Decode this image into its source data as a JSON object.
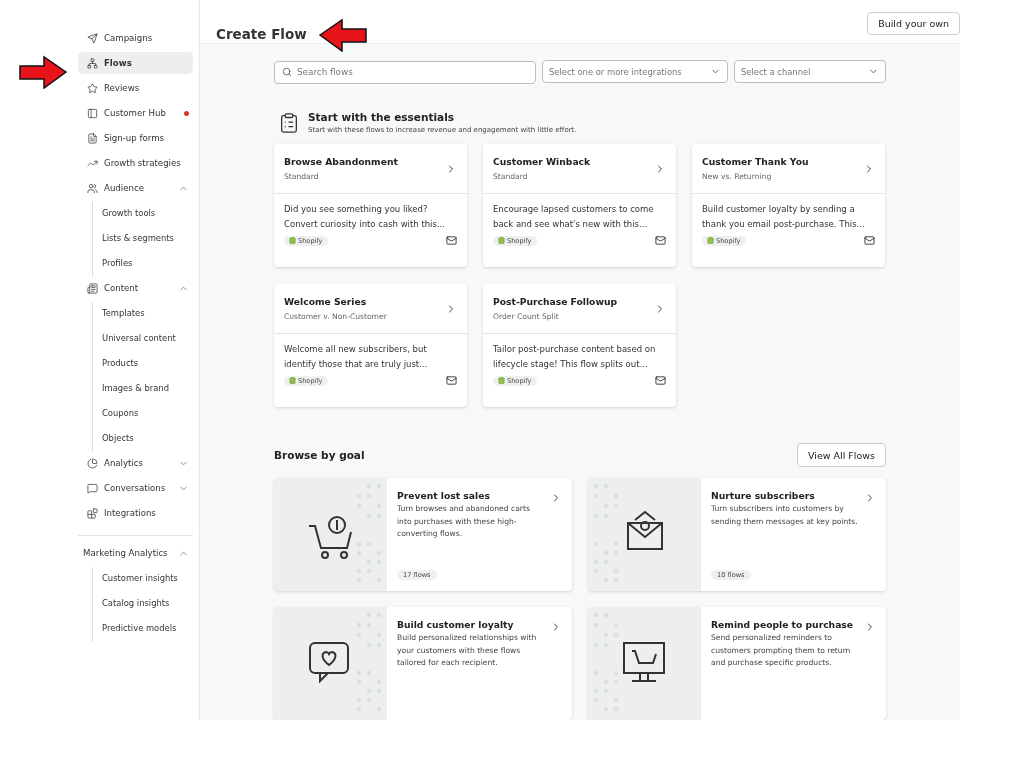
{
  "sidebar": {
    "items": [
      {
        "label": "Campaigns",
        "selected": false,
        "notification": false
      },
      {
        "label": "Flows",
        "selected": true,
        "notification": false
      },
      {
        "label": "Reviews",
        "selected": false,
        "notification": false
      },
      {
        "label": "Customer Hub",
        "selected": false,
        "notification": true
      },
      {
        "label": "Sign-up forms",
        "selected": false,
        "notification": false
      },
      {
        "label": "Growth strategies",
        "selected": false,
        "notification": false
      },
      {
        "label": "Audience",
        "selected": false,
        "notification": false,
        "expanded": true,
        "children": [
          {
            "label": "Growth tools",
            "selected": false
          },
          {
            "label": "Lists & segments",
            "selected": false
          },
          {
            "label": "Profiles",
            "selected": false
          }
        ]
      },
      {
        "label": "Content",
        "selected": false,
        "notification": false,
        "expanded": true,
        "children": [
          {
            "label": "Templates",
            "selected": false
          },
          {
            "label": "Universal content",
            "selected": false
          },
          {
            "label": "Products",
            "selected": false
          },
          {
            "label": "Images & brand",
            "selected": false
          },
          {
            "label": "Coupons",
            "selected": false
          },
          {
            "label": "Objects",
            "selected": false
          }
        ]
      },
      {
        "label": "Analytics",
        "selected": false,
        "notification": false,
        "expanded": false
      },
      {
        "label": "Conversations",
        "selected": false,
        "notification": false,
        "expanded": false
      },
      {
        "label": "Integrations",
        "selected": false,
        "notification": false
      }
    ],
    "section": {
      "label": "Marketing Analytics",
      "expanded": true,
      "children": [
        {
          "label": "Customer insights",
          "selected": false
        },
        {
          "label": "Catalog insights",
          "selected": false
        },
        {
          "label": "Predictive models",
          "selected": false
        }
      ]
    }
  },
  "header": {
    "title": "Create Flow",
    "button": "Build your own"
  },
  "filters": {
    "search": {
      "placeholder": "Search flows"
    },
    "integrations": {
      "placeholder": "Select one or more integrations"
    },
    "channel": {
      "placeholder": "Select a channel"
    }
  },
  "essentials": {
    "title": "Start with the essentials",
    "subtitle": "Start with these flows to increase revenue and engagement with little effort.",
    "cards": [
      {
        "title": "Browse Abandonment",
        "subtitle": "Standard",
        "description": "Did you see something you liked? Convert curiosity into cash with this...",
        "tag": "Shopify"
      },
      {
        "title": "Customer Winback",
        "subtitle": "Standard",
        "description": "Encourage lapsed customers to come back and see what's new with this...",
        "tag": "Shopify"
      },
      {
        "title": "Customer Thank You",
        "subtitle": "New vs. Returning",
        "description": "Build customer loyalty by sending a thank you email post-purchase. This...",
        "tag": "Shopify"
      },
      {
        "title": "Welcome Series",
        "subtitle": "Customer v. Non-Customer",
        "description": "Welcome all new subscribers, but identify those that are truly just...",
        "tag": "Shopify"
      },
      {
        "title": "Post-Purchase Followup",
        "subtitle": "Order Count Split",
        "description": "Tailor post-purchase content based on lifecycle stage! This flow splits out...",
        "tag": "Shopify"
      }
    ]
  },
  "goals": {
    "title": "Browse by goal",
    "button": "View All Flows",
    "cards": [
      {
        "title": "Prevent lost sales",
        "description": "Turn browses and abandoned carts into purchases with these high-converting flows.",
        "count": "17 flows"
      },
      {
        "title": "Nurture subscribers",
        "description": "Turn subscribers into customers by sending them messages at key points.",
        "count": "10 flows"
      },
      {
        "title": "Build customer loyalty",
        "description": "Build personalized relationships with your customers with these flows tailored for each recipient."
      },
      {
        "title": "Remind people to purchase",
        "description": "Send personalized reminders to customers prompting them to return and purchase specific products."
      }
    ]
  }
}
